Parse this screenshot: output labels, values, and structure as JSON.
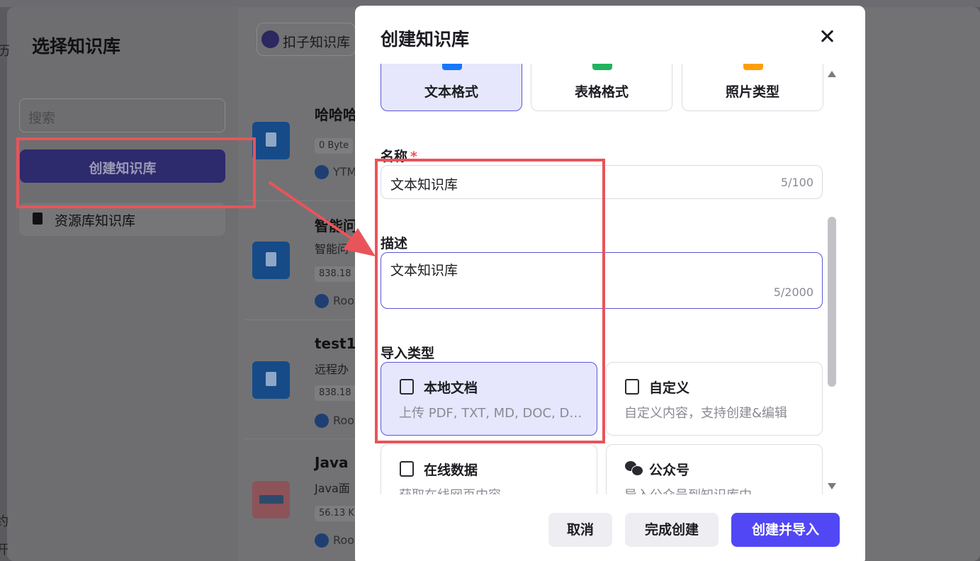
{
  "background": {
    "dialog_title": "选择知识库",
    "search_placeholder": "搜索",
    "create_button": "创建知识库",
    "resource_item": "资源库知识库",
    "chip_label": "扣子知识库",
    "left_edge_glyphs": [
      "历",
      "约",
      "开"
    ],
    "items": [
      {
        "name": "哈哈哈",
        "desc": "",
        "size": "0 Byte",
        "owner": "YTM"
      },
      {
        "name": "智能问",
        "desc": "智能问",
        "size": "838.18",
        "owner": "Roo"
      },
      {
        "name": "test1",
        "desc": "远程办",
        "size": "838.18",
        "owner": "Roo"
      },
      {
        "name": "Java",
        "desc": "Java面",
        "size": "56.13 K",
        "owner": "Roo"
      }
    ]
  },
  "modal": {
    "title": "创建知识库",
    "formats": [
      {
        "label": "文本格式",
        "icon": "doc-blue-icon",
        "color": "#1677ff",
        "active": true
      },
      {
        "label": "表格格式",
        "icon": "table-green-icon",
        "color": "#22b35e",
        "active": false
      },
      {
        "label": "照片类型",
        "icon": "image-orange-icon",
        "color": "#ff9f0a",
        "active": false
      }
    ],
    "name_field": {
      "label": "名称",
      "required_mark": "*",
      "value": "文本知识库",
      "counter": "5/100"
    },
    "desc_field": {
      "label": "描述",
      "value": "文本知识库",
      "counter": "5/2000"
    },
    "import_type": {
      "label": "导入类型",
      "options": [
        {
          "title": "本地文档",
          "subtitle": "上传 PDF, TXT, MD, DOC, DOCX 格式的本地文件",
          "icon": "document-icon",
          "active": true
        },
        {
          "title": "自定义",
          "subtitle": "自定义内容，支持创建&编辑",
          "icon": "edit-doc-icon",
          "active": false
        },
        {
          "title": "在线数据",
          "subtitle": "获取在线网页内容",
          "icon": "web-data-icon",
          "active": false
        },
        {
          "title": "公众号",
          "subtitle": "导入公众号到知识库中",
          "icon": "wechat-icon",
          "active": false
        }
      ]
    },
    "footer": {
      "cancel": "取消",
      "finish": "完成创建",
      "create_import": "创建并导入"
    }
  },
  "colors": {
    "accent": "#5147f5",
    "annotation": "#e9545a",
    "selected_bg": "#e6e7fc"
  }
}
